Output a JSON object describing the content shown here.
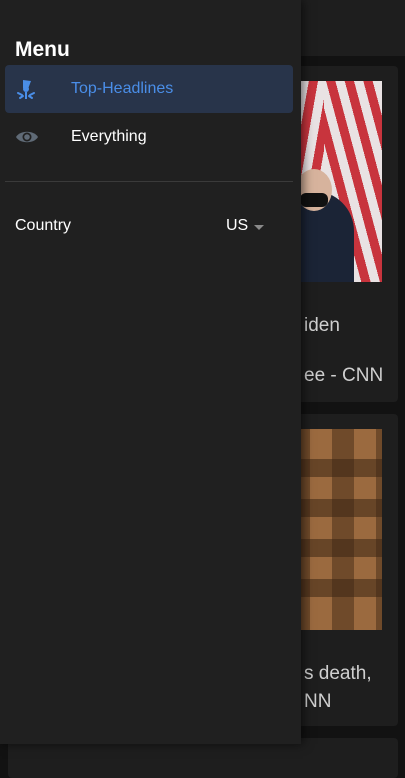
{
  "drawer": {
    "title": "Menu",
    "items": [
      {
        "label": "Top-Headlines",
        "icon": "broadcast-icon",
        "active": true
      },
      {
        "label": "Everything",
        "icon": "eye-icon",
        "active": false
      }
    ],
    "country": {
      "label": "Country",
      "value": "US"
    }
  },
  "background": {
    "cards": [
      {
        "line1": "iden",
        "line2": "ee - CNN"
      },
      {
        "line1": "s death,",
        "line2": "NN"
      }
    ]
  },
  "colors": {
    "accent": "#4a8ee8",
    "drawer_bg": "#202020",
    "active_bg": "#28344a"
  }
}
